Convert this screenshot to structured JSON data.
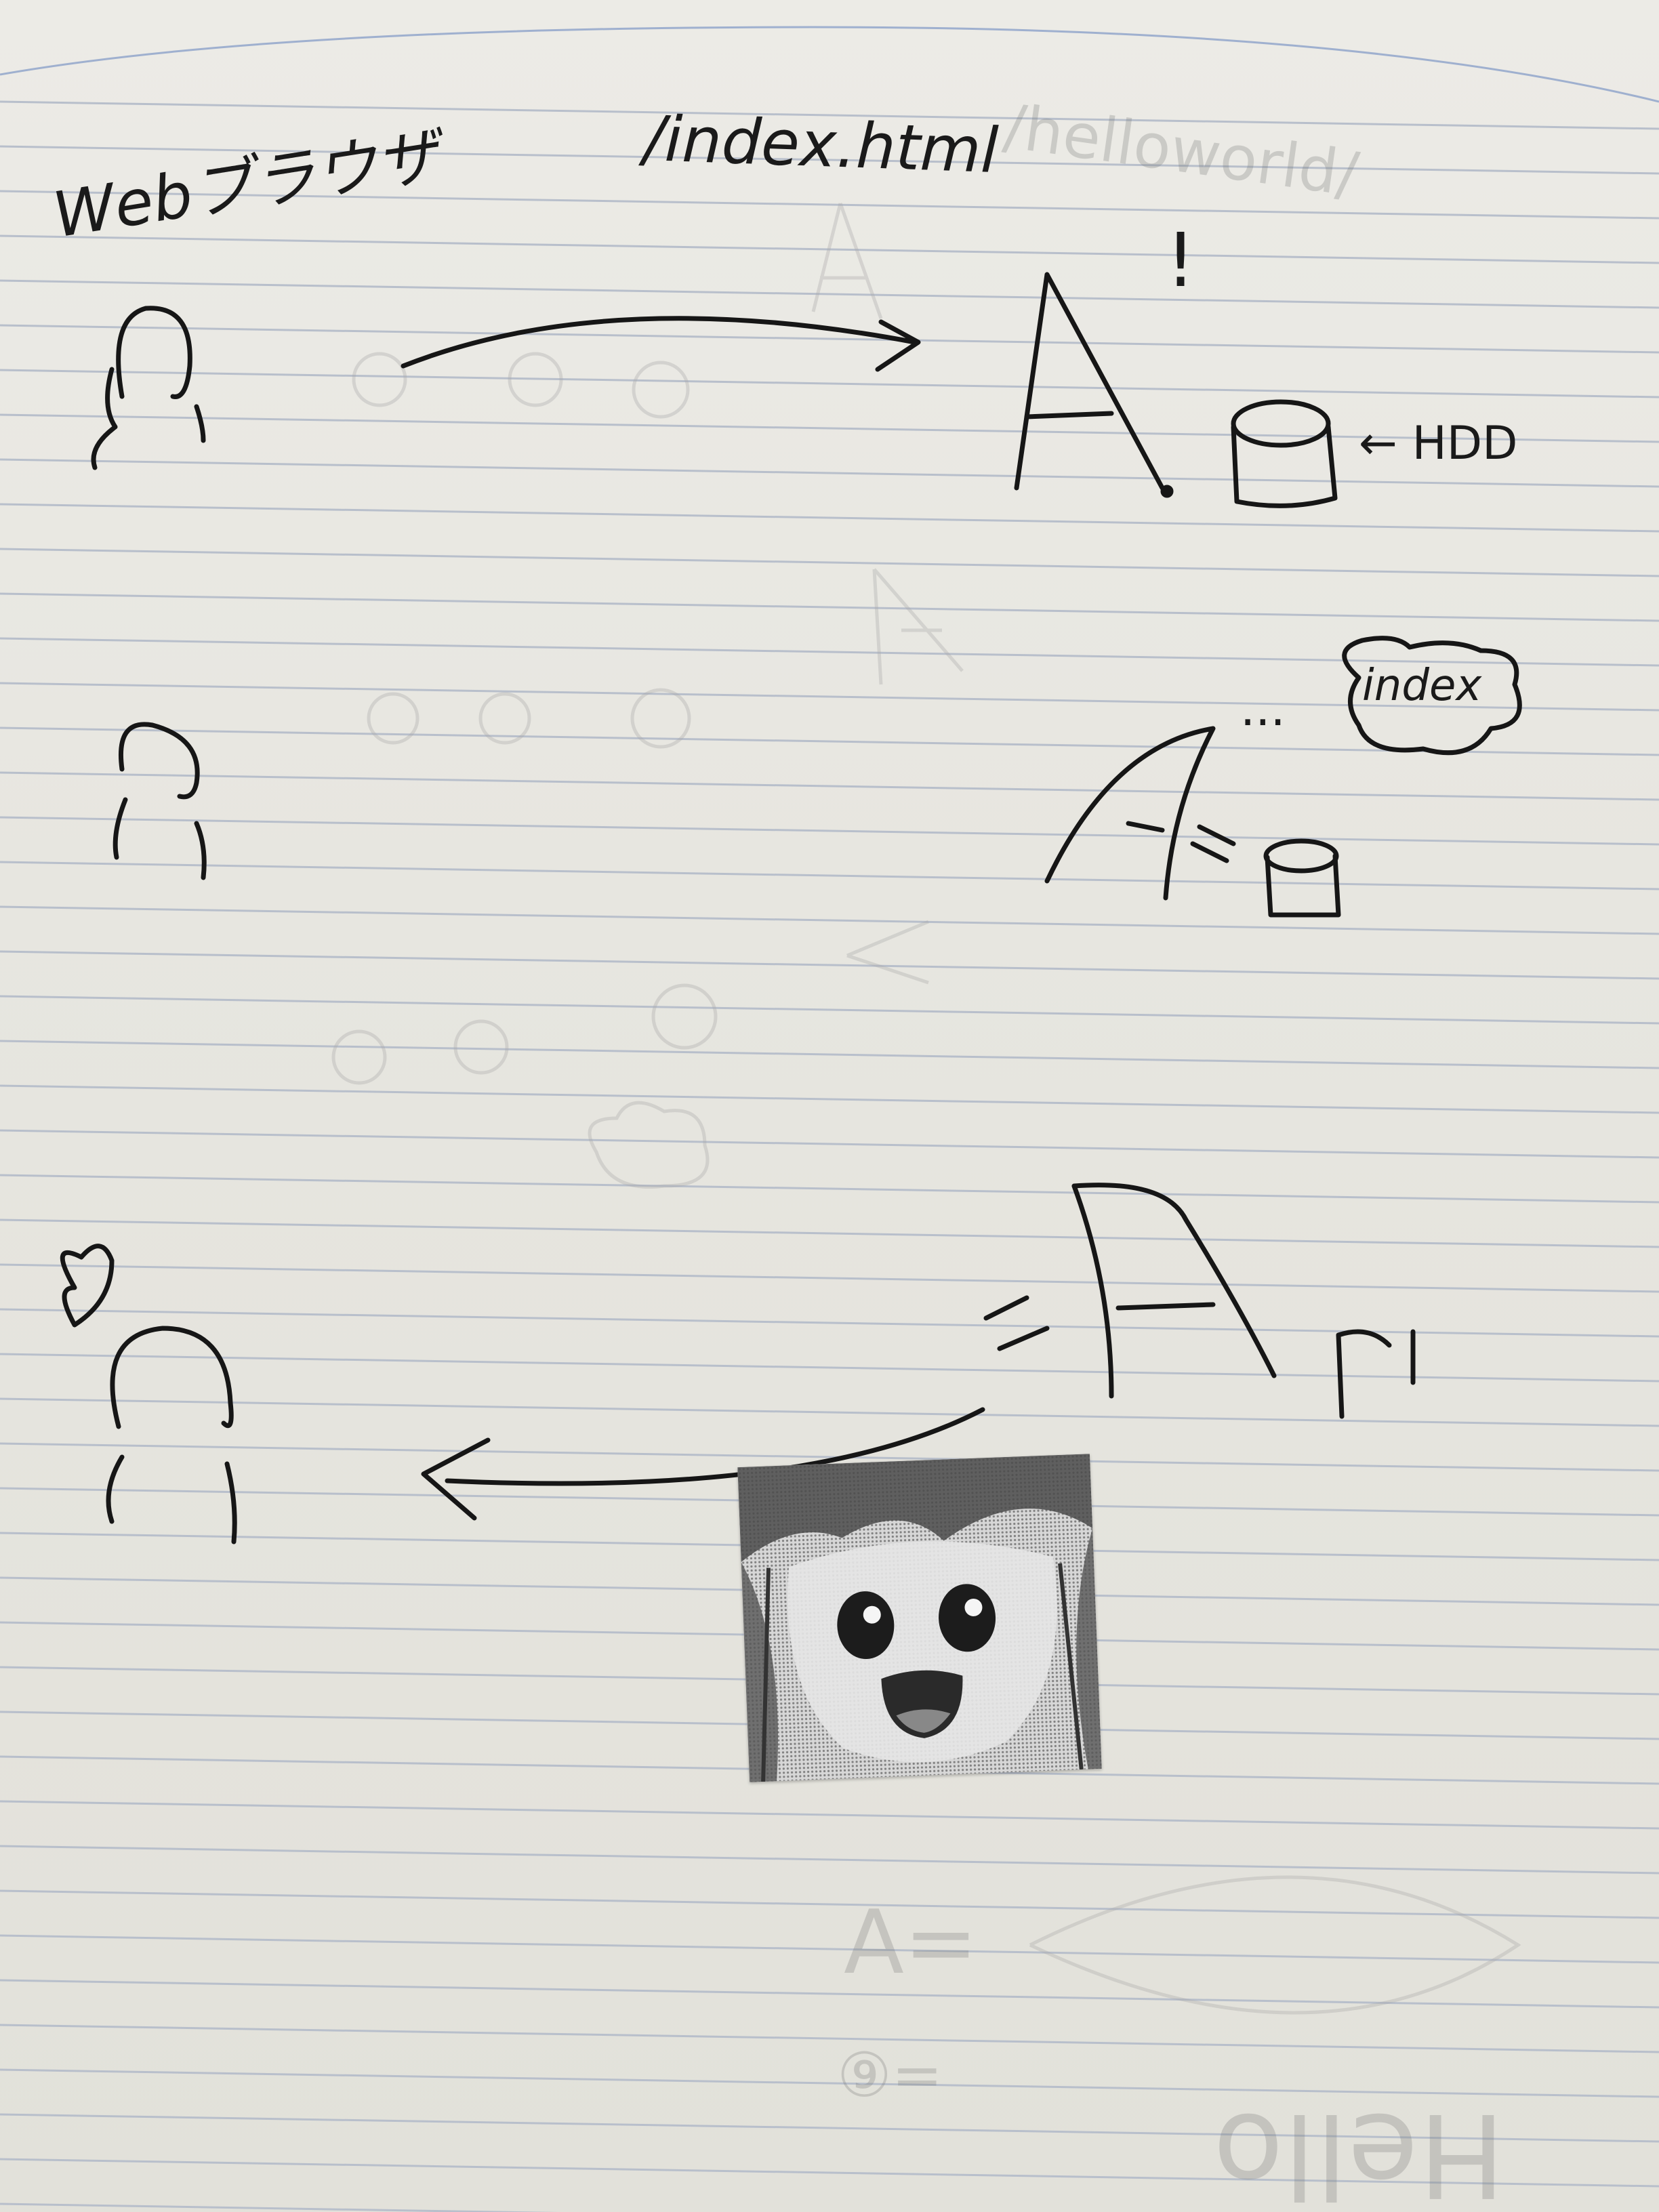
{
  "labels": {
    "browser": "Webブラウザ",
    "path": "/index.html",
    "exclaim": "!",
    "hdd": "← HDD",
    "index_bubble": "index",
    "dots": "...",
    "speaker_letter": "A",
    "small_glyph": "ﾞ"
  },
  "background_ghost": {
    "hello": "Hello",
    "helloworld": "/helloworld/",
    "a_eq": "A=",
    "q_eq": "⑨="
  },
  "colors": {
    "paper": "#e8e7e1",
    "rule_line": "#b9c0cc",
    "ink": "#1a1a1a",
    "ghost": "#9a9a9a"
  },
  "icons": {
    "person": "stick-figure",
    "server": "letter-A",
    "disk": "cylinder-hdd",
    "thought": "cloud-bubble",
    "heart": "heart-outline"
  }
}
